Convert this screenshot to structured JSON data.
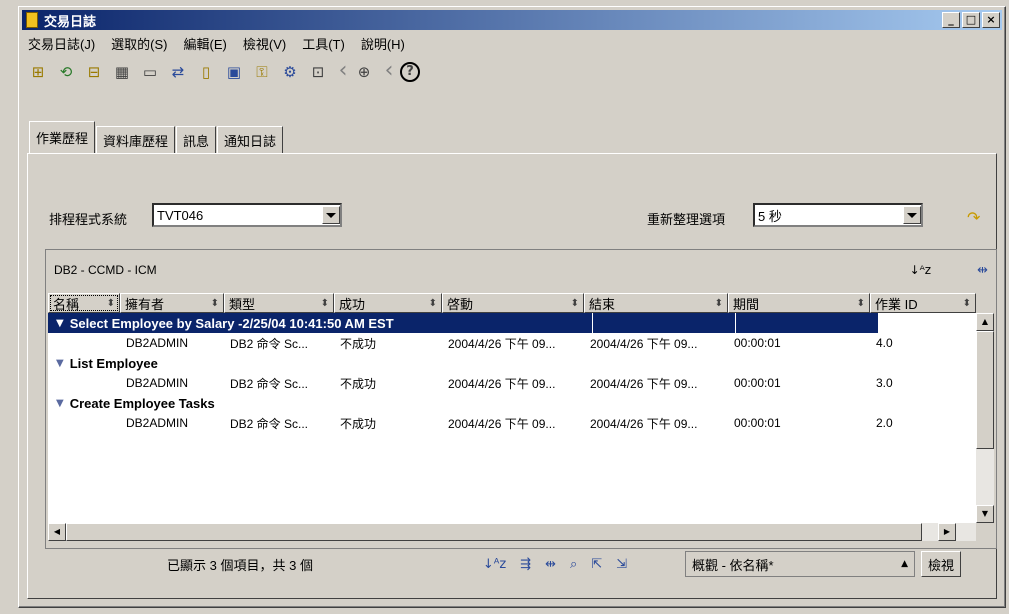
{
  "window": {
    "title": "交易日誌"
  },
  "menu": [
    "交易日誌(J)",
    "選取的(S)",
    "編輯(E)",
    "檢視(V)",
    "工具(T)",
    "說明(H)"
  ],
  "tabs": [
    "作業歷程",
    "資料庫歷程",
    "訊息",
    "通知日誌"
  ],
  "filters": {
    "system_label": "排程程式系統",
    "system_value": "TVT046",
    "refresh_label": "重新整理選項",
    "refresh_value": "5 秒"
  },
  "table": {
    "caption": "DB2 - CCMD - ICM",
    "columns": [
      "名稱",
      "擁有者",
      "類型",
      "成功",
      "啓動",
      "結束",
      "期間",
      "作業 ID"
    ],
    "groups": [
      {
        "name": "Select Employee by Salary -2/25/04 10:41:50 AM EST",
        "selected": true,
        "row": {
          "owner": "DB2ADMIN",
          "type": "DB2 命令 Sc...",
          "success": "不成功",
          "start": "2004/4/26 下午 09...",
          "end": "2004/4/26 下午 09...",
          "duration": "00:00:01",
          "job_id": "4.0"
        }
      },
      {
        "name": "List Employee",
        "selected": false,
        "row": {
          "owner": "DB2ADMIN",
          "type": "DB2 命令 Sc...",
          "success": "不成功",
          "start": "2004/4/26 下午 09...",
          "end": "2004/4/26 下午 09...",
          "duration": "00:00:01",
          "job_id": "3.0"
        }
      },
      {
        "name": "Create Employee Tasks",
        "selected": false,
        "row": {
          "owner": "DB2ADMIN",
          "type": "DB2 命令 Sc...",
          "success": "不成功",
          "start": "2004/4/26 下午 09...",
          "end": "2004/4/26 下午 09...",
          "duration": "00:00:01",
          "job_id": "2.0"
        }
      }
    ]
  },
  "status": {
    "text": "已顯示 3 個項目，共 3 個",
    "view_value": "概觀 - 依名稱*",
    "view_button": "檢視"
  },
  "colors": {
    "title_start": "#0a246a",
    "title_end": "#a6caf0",
    "selection": "#0a246a"
  }
}
